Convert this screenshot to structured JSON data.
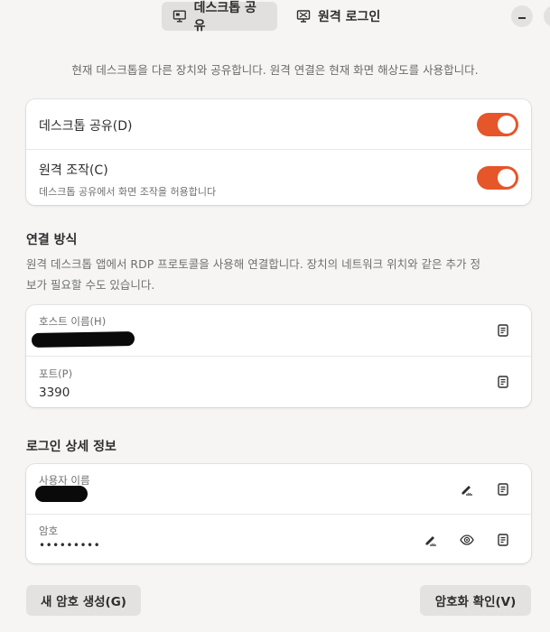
{
  "header": {
    "tabs": [
      {
        "label": "데스크톱 공유",
        "icon": "desktop-share-icon",
        "active": true
      },
      {
        "label": "원격 로그인",
        "icon": "remote-login-icon",
        "active": false
      }
    ]
  },
  "description": "현재 데스크톱을 다른 장치와 공유합니다. 원격 연결은 현재 화면 해상도를 사용합니다.",
  "sharing": {
    "desktop_sharing": {
      "label": "데스크톱 공유(D)",
      "enabled": true
    },
    "remote_control": {
      "label": "원격 조작(C)",
      "subtitle": "데스크톱 공유에서 화면 조작을 허용합니다",
      "enabled": true
    }
  },
  "connection": {
    "title": "연결 방식",
    "description_line1": "원격 데스크톱 앱에서 RDP 프로토콜을 사용해 연결합니다. 장치의 네트워크 위치와 같은 추가 정",
    "description_line2": "보가 필요할 수도 있습니다.",
    "hostname": {
      "label": "호스트 이름(H)",
      "value": ""
    },
    "port": {
      "label": "포트(P)",
      "value": "3390"
    }
  },
  "login": {
    "title": "로그인 상세 정보",
    "username": {
      "label": "사용자 이름",
      "value": ""
    },
    "password": {
      "label": "암호",
      "value": "•••••••••"
    }
  },
  "buttons": {
    "generate_password": "새 암호 생성(G)",
    "verify_encryption": "암호화 확인(V)"
  },
  "colors": {
    "accent": "#e5562b",
    "background": "#f6f5f4",
    "card": "#ffffff"
  }
}
